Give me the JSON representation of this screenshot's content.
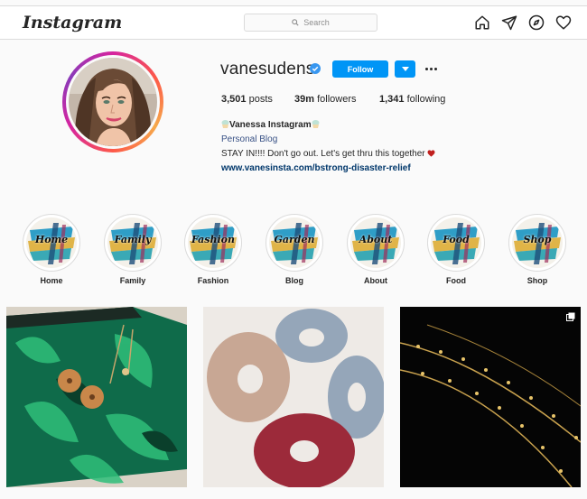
{
  "header": {
    "logo": "Instagram",
    "search_placeholder": "Search"
  },
  "profile": {
    "username": "vanesudens",
    "verified": true,
    "follow_label": "Follow",
    "stats": {
      "posts": "3,501",
      "posts_label": "posts",
      "followers": "39m",
      "followers_label": "followers",
      "following": "1,341",
      "following_label": "following"
    },
    "bio": {
      "name": "Vanessa Instagram",
      "category": "Personal Blog",
      "text": "STAY IN!!!! Don't go out. Let's get thru this together",
      "link": "www.vanesinsta.com/bstrong-disaster-relief"
    }
  },
  "highlights": [
    {
      "label": "Home",
      "cover": "Home"
    },
    {
      "label": "Family",
      "cover": "Family"
    },
    {
      "label": "Fashion",
      "cover": "Fashion"
    },
    {
      "label": "Blog",
      "cover": "Garden"
    },
    {
      "label": "About",
      "cover": "About"
    },
    {
      "label": "Food",
      "cover": "Food"
    },
    {
      "label": "Shop",
      "cover": "Shop"
    }
  ],
  "colors": {
    "accent": "#0095f6",
    "link": "#00376b",
    "category": "#385185",
    "heart": "#c0201e"
  },
  "icons": [
    "home-icon",
    "direct-icon",
    "explore-icon",
    "heart-icon",
    "search-icon",
    "verified-badge-icon",
    "carousel-icon"
  ]
}
